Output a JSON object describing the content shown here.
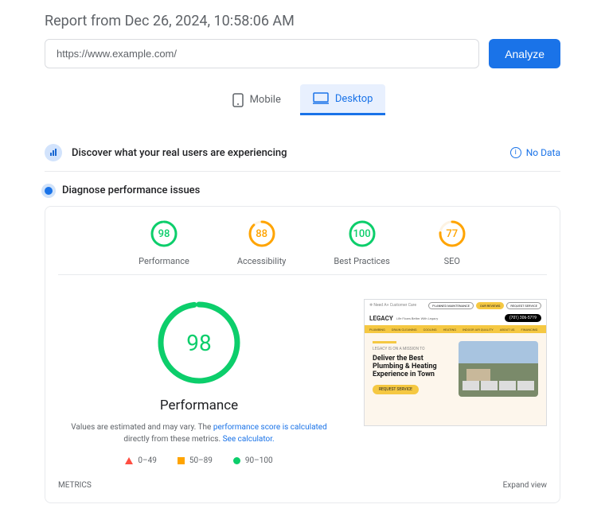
{
  "report_title": "Report from Dec 26, 2024, 10:58:06 AM",
  "url_value": "https://www.example.com/",
  "analyze_label": "Analyze",
  "tabs": {
    "mobile": "Mobile",
    "desktop": "Desktop"
  },
  "discover": {
    "title": "Discover what your real users are experiencing",
    "nodata": "No Data"
  },
  "diagnose": {
    "title": "Diagnose performance issues"
  },
  "gauges": {
    "performance": {
      "label": "Performance",
      "value": "98",
      "color": "#0cce6b"
    },
    "accessibility": {
      "label": "Accessibility",
      "value": "88",
      "color": "#ffa400"
    },
    "best": {
      "label": "Best Practices",
      "value": "100",
      "color": "#0cce6b"
    },
    "seo": {
      "label": "SEO",
      "value": "77",
      "color": "#ffa400"
    }
  },
  "big": {
    "value": "98",
    "label": "Performance"
  },
  "desc": {
    "line1": "Values are estimated and may vary. The ",
    "link1": "performance score is calculated",
    "line2": " directly from these metrics. ",
    "link2": "See calculator."
  },
  "legend": {
    "r1": "0–49",
    "r2": "50–89",
    "r3": "90–100"
  },
  "thumb": {
    "logo": "LEGACY",
    "tagline": "Life Flows Better With Legacy",
    "phone": "(701) 306-5719",
    "mission": "LEGACY IS ON A MISSION TO",
    "headline": "Deliver the Best Plumbing & Heating Experience in Town",
    "cta": "REQUEST SERVICE",
    "nav": [
      "PLUMBING",
      "DRAIN CLEANING",
      "COOLING",
      "HEATING",
      "INDOOR AIR QUALITY",
      "ABOUT US",
      "FINANCING"
    ],
    "pills": [
      "PLANNED MAINTENANCE",
      "OUR REVIEWS",
      "REQUEST SERVICE"
    ]
  },
  "metrics_label": "METRICS",
  "expand_label": "Expand view"
}
